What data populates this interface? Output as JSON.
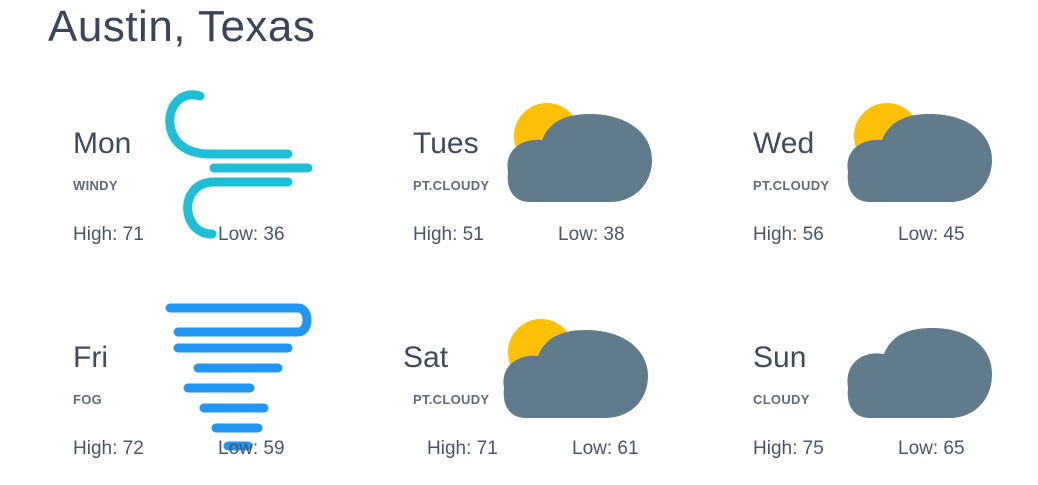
{
  "city": "Austin, Texas",
  "colors": {
    "wind": "#1ebfd6",
    "fog": "#2196f3",
    "sun": "#fec107",
    "cloud": "#607b8b",
    "text": "#3f4b5b"
  },
  "days": [
    {
      "day": "Mon",
      "condition": "WINDY",
      "high": "High: 71",
      "low": "Low: 36",
      "icon": "wind-icon"
    },
    {
      "day": "Tues",
      "condition": "PT.CLOUDY",
      "high": "High: 51",
      "low": "Low: 38",
      "icon": "partly-cloudy-icon"
    },
    {
      "day": "Wed",
      "condition": "PT.CLOUDY",
      "high": "High: 56",
      "low": "Low: 45",
      "icon": "partly-cloudy-icon"
    },
    {
      "day": "Fri",
      "condition": "FOG",
      "high": "High: 72",
      "low": "Low: 59",
      "icon": "fog-icon"
    },
    {
      "day": "Sat",
      "condition": "PT.CLOUDY",
      "high": "High: 71",
      "low": "Low: 61",
      "icon": "partly-cloudy-icon"
    },
    {
      "day": "Sun",
      "condition": "CLOUDY",
      "high": "High: 75",
      "low": "Low: 65",
      "icon": "cloud-icon"
    }
  ]
}
